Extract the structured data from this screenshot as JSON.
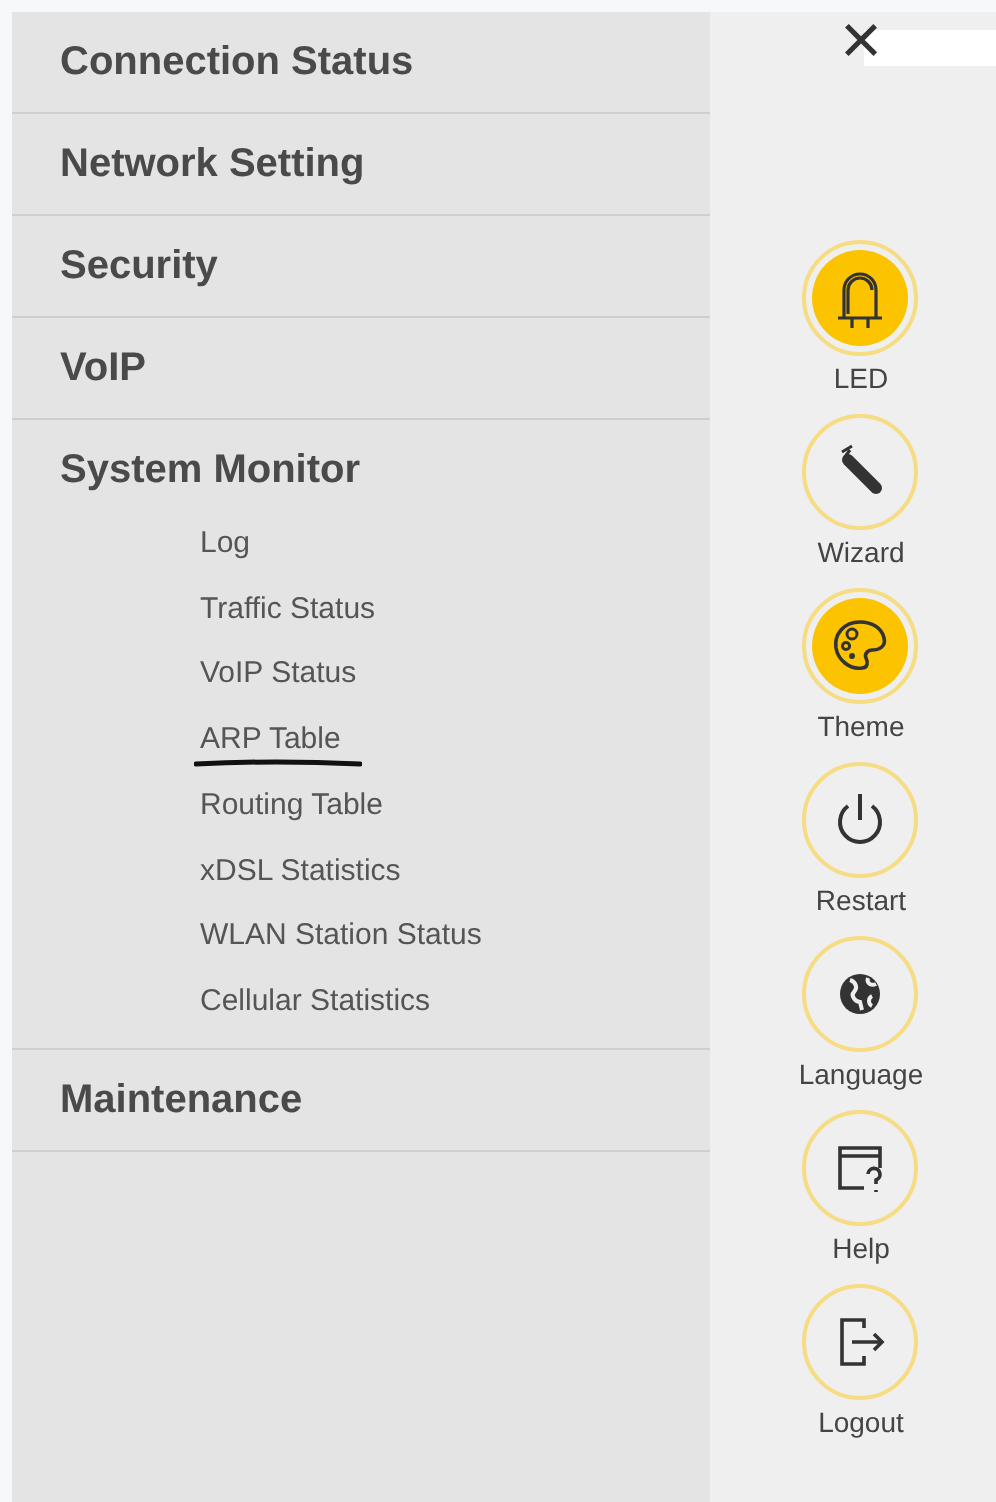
{
  "menu": [
    {
      "label": "Connection Status",
      "expanded": false
    },
    {
      "label": "Network Setting",
      "expanded": false
    },
    {
      "label": "Security",
      "expanded": false
    },
    {
      "label": "VoIP",
      "expanded": false
    },
    {
      "label": "System Monitor",
      "expanded": true,
      "children": [
        {
          "label": "Log",
          "underlined": false
        },
        {
          "label": "Traffic Status",
          "underlined": false
        },
        {
          "label": "VoIP Status",
          "underlined": false
        },
        {
          "label": "ARP Table",
          "underlined": true
        },
        {
          "label": "Routing Table",
          "underlined": false
        },
        {
          "label": "xDSL Statistics",
          "underlined": false
        },
        {
          "label": "WLAN Station Status",
          "underlined": false
        },
        {
          "label": "Cellular Statistics",
          "underlined": false
        }
      ]
    },
    {
      "label": "Maintenance",
      "expanded": false
    }
  ],
  "close_button": {
    "label": "×"
  },
  "actions": [
    {
      "kind": "led",
      "label": "LED",
      "on": true
    },
    {
      "kind": "wizard",
      "label": "Wizard",
      "on": false
    },
    {
      "kind": "theme",
      "label": "Theme",
      "on": true
    },
    {
      "kind": "restart",
      "label": "Restart",
      "on": false
    },
    {
      "kind": "language",
      "label": "Language",
      "on": false
    },
    {
      "kind": "help",
      "label": "Help",
      "on": false
    },
    {
      "kind": "logout",
      "label": "Logout",
      "on": false
    }
  ]
}
